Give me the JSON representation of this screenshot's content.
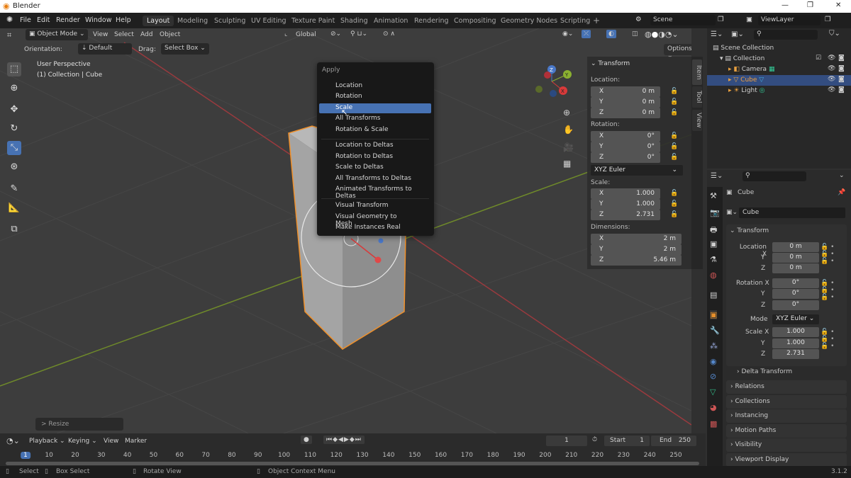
{
  "window": {
    "title": "Blender",
    "minimize": "—",
    "maximize": "❐",
    "close": "✕"
  },
  "menubar": {
    "items": [
      "File",
      "Edit",
      "Render",
      "Window",
      "Help"
    ],
    "workspaces": [
      "Layout",
      "Modeling",
      "Sculpting",
      "UV Editing",
      "Texture Paint",
      "Shading",
      "Animation",
      "Rendering",
      "Compositing",
      "Geometry Nodes",
      "Scripting"
    ],
    "add_tab": "+",
    "scene": "Scene",
    "view_layer": "ViewLayer"
  },
  "viewport_header": {
    "mode": "Object Mode",
    "menus": [
      "View",
      "Select",
      "Add",
      "Object"
    ],
    "orientation_global": "Global",
    "options": "Options"
  },
  "tool_settings": {
    "orientation_label": "Orientation:",
    "orientation_value": "Default",
    "drag_label": "Drag:",
    "drag_value": "Select Box"
  },
  "viewport": {
    "perspective": "User Perspective",
    "collection_info": "(1) Collection | Cube",
    "last_op": "> Resize",
    "gizmo": {
      "x": "X",
      "y": "Y",
      "z": "Z"
    }
  },
  "apply_menu": {
    "title": "Apply",
    "groups": [
      [
        "Location",
        "Rotation",
        "Scale",
        "All Transforms",
        "Rotation & Scale"
      ],
      [
        "Location to Deltas",
        "Rotation to Deltas",
        "Scale to Deltas",
        "All Transforms to Deltas",
        "Animated Transforms to Deltas"
      ],
      [
        "Visual Transform",
        "Visual Geometry to Mesh",
        "Make Instances Real"
      ]
    ],
    "selected": "Scale"
  },
  "npanel": {
    "title": "Transform",
    "location_label": "Location:",
    "rotation_label": "Rotation:",
    "scale_label": "Scale:",
    "dimensions_label": "Dimensions:",
    "location": [
      [
        "X",
        "0 m"
      ],
      [
        "Y",
        "0 m"
      ],
      [
        "Z",
        "0 m"
      ]
    ],
    "rotation": [
      [
        "X",
        "0°"
      ],
      [
        "Y",
        "0°"
      ],
      [
        "Z",
        "0°"
      ]
    ],
    "rotation_mode": "XYZ Euler",
    "scale": [
      [
        "X",
        "1.000"
      ],
      [
        "Y",
        "1.000"
      ],
      [
        "Z",
        "2.731"
      ]
    ],
    "dimensions": [
      [
        "X",
        "2 m"
      ],
      [
        "Y",
        "2 m"
      ],
      [
        "Z",
        "5.46 m"
      ]
    ],
    "tabs": [
      "Item",
      "Tool",
      "View"
    ]
  },
  "outliner": {
    "root": "Scene Collection",
    "collection": "Collection",
    "objects": [
      "Camera",
      "Cube",
      "Light"
    ],
    "selected": "Cube"
  },
  "properties": {
    "object_name": "Cube",
    "data_name": "Cube",
    "section": "Transform",
    "location_label": "Location X",
    "rotation_label": "Rotation X",
    "mode_label": "Mode",
    "scale_label": "Scale X",
    "y": "Y",
    "z": "Z",
    "location": [
      "0 m",
      "0 m",
      "0 m"
    ],
    "rotation": [
      "0°",
      "0°",
      "0°"
    ],
    "mode": "XYZ Euler",
    "scale": [
      "1.000",
      "1.000",
      "2.731"
    ],
    "delta": "Delta Transform",
    "panels": [
      "Relations",
      "Collections",
      "Instancing",
      "Motion Paths",
      "Visibility",
      "Viewport Display"
    ]
  },
  "timeline": {
    "menus": [
      "Playback",
      "Keying",
      "View",
      "Marker"
    ],
    "current_frame": "1",
    "start_label": "Start",
    "start": "1",
    "end_label": "End",
    "end": "250",
    "ticks": [
      "1",
      "10",
      "20",
      "30",
      "40",
      "50",
      "60",
      "70",
      "80",
      "90",
      "100",
      "110",
      "120",
      "130",
      "140",
      "150",
      "160",
      "170",
      "180",
      "190",
      "200",
      "210",
      "220",
      "230",
      "240",
      "250"
    ]
  },
  "statusbar": {
    "select": "Select",
    "box_select": "Box Select",
    "rotate_view": "Rotate View",
    "context_menu": "Object Context Menu",
    "version": "3.1.2"
  },
  "colors": {
    "accent": "#4772b3",
    "selection_outline": "#f0902a",
    "axis_x": "#b0393e",
    "axis_y": "#6f9a2a"
  }
}
